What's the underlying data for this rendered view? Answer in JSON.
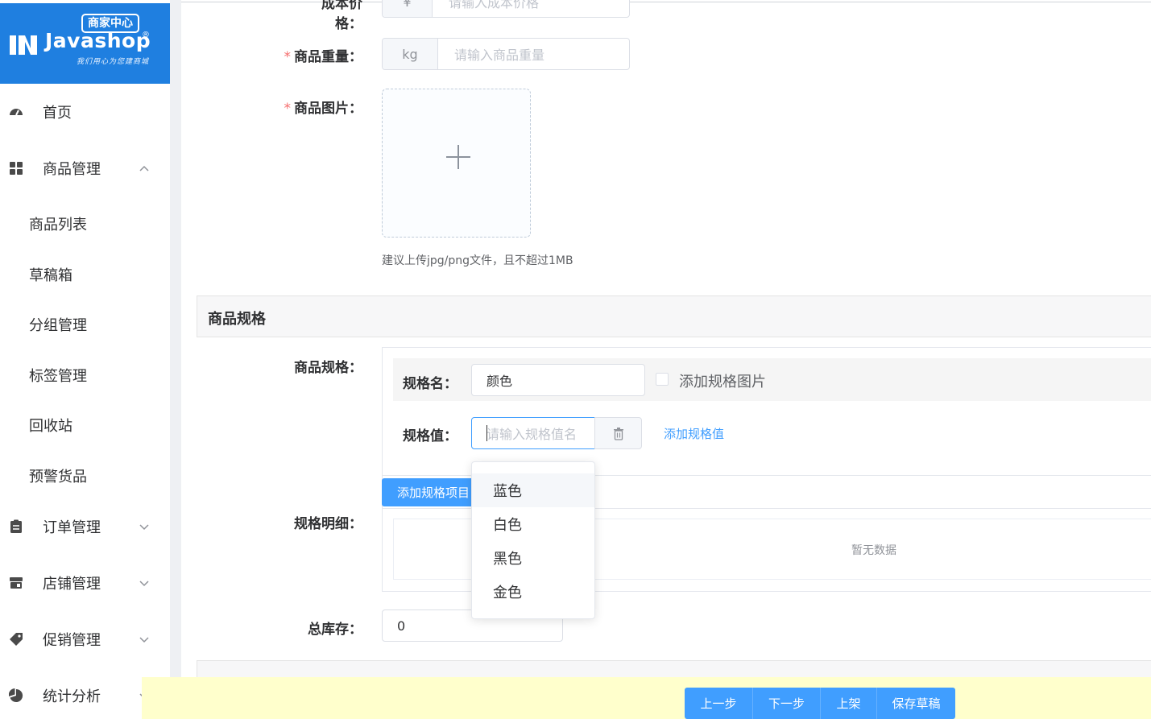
{
  "brand": {
    "badge": "商家中心",
    "name": "Javashop",
    "reg_mark": "®",
    "slogan": "我们用心为您建商城"
  },
  "sidebar": {
    "items": [
      {
        "label": "首页",
        "icon": "dashboard-icon"
      },
      {
        "label": "商品管理",
        "icon": "grid-icon",
        "expanded": true
      },
      {
        "label": "商品列表"
      },
      {
        "label": "草稿箱"
      },
      {
        "label": "分组管理"
      },
      {
        "label": "标签管理"
      },
      {
        "label": "回收站"
      },
      {
        "label": "预警货品"
      },
      {
        "label": "订单管理",
        "icon": "clipboard-icon"
      },
      {
        "label": "店铺管理",
        "icon": "store-icon"
      },
      {
        "label": "促销管理",
        "icon": "tag-icon"
      },
      {
        "label": "统计分析",
        "icon": "pie-chart-icon"
      }
    ]
  },
  "form": {
    "cost_price": {
      "label": "成本价格：",
      "prefix": "¥",
      "placeholder": "请输入成本价格"
    },
    "weight": {
      "label": "商品重量：",
      "prefix": "kg",
      "placeholder": "请输入商品重量"
    },
    "image": {
      "label": "商品图片：",
      "tip": "建议上传jpg/png文件，且不超过1MB"
    },
    "required_mark": "*"
  },
  "spec_section": {
    "title": "商品规格",
    "label": "商品规格：",
    "name_label": "规格名：",
    "name_value": "颜色",
    "add_image_label": "添加规格图片",
    "value_label": "规格值：",
    "value_placeholder": "请输入规格值名",
    "add_value_link": "添加规格值",
    "add_item_button": "添加规格项目",
    "detail_label": "规格明细：",
    "empty_text": "暂无数据",
    "stock_label": "总库存：",
    "stock_value": "0",
    "dropdown_options": [
      "蓝色",
      "白色",
      "黑色",
      "金色"
    ]
  },
  "footer": {
    "prev": "上一步",
    "next": "下一步",
    "publish": "上架",
    "save_draft": "保存草稿"
  },
  "colors": {
    "brand": "#1f7fe0",
    "primary": "#409eff",
    "required": "#f56c6c",
    "footer_bg": "#ffffcc"
  }
}
